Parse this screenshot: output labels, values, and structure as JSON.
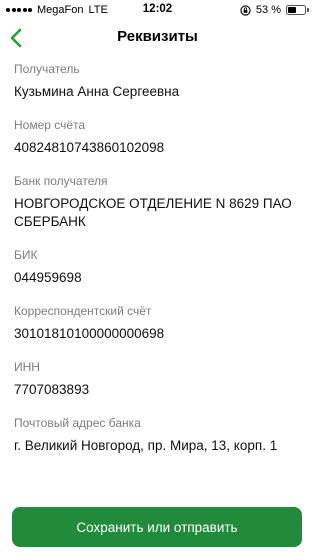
{
  "status_bar": {
    "carrier": "MegaFon",
    "network": "LTE",
    "time": "12:02",
    "battery_text": "53 %",
    "battery_level": 0.53
  },
  "header": {
    "title": "Реквизиты",
    "back_icon": "chevron-left-icon",
    "accent_color": "#21a038"
  },
  "fields": [
    {
      "label": "Получатель",
      "value": "Кузьмина Анна Сергеевна"
    },
    {
      "label": "Номер счёта",
      "value": "40824810743860102098"
    },
    {
      "label": "Банк получателя",
      "value": "НОВГОРОДСКОЕ ОТДЕЛЕНИЕ N 8629 ПАО СБЕРБАНК"
    },
    {
      "label": "БИК",
      "value": "044959698"
    },
    {
      "label": "Корреспондентский счёт",
      "value": "30101810100000000698"
    },
    {
      "label": "ИНН",
      "value": "7707083893"
    },
    {
      "label": "Почтовый адрес банка",
      "value": "г. Великий Новгород, пр. Мира, 13, корп. 1"
    }
  ],
  "actions": {
    "save_or_send_label": "Сохранить или отправить",
    "button_color": "#218a3b"
  }
}
